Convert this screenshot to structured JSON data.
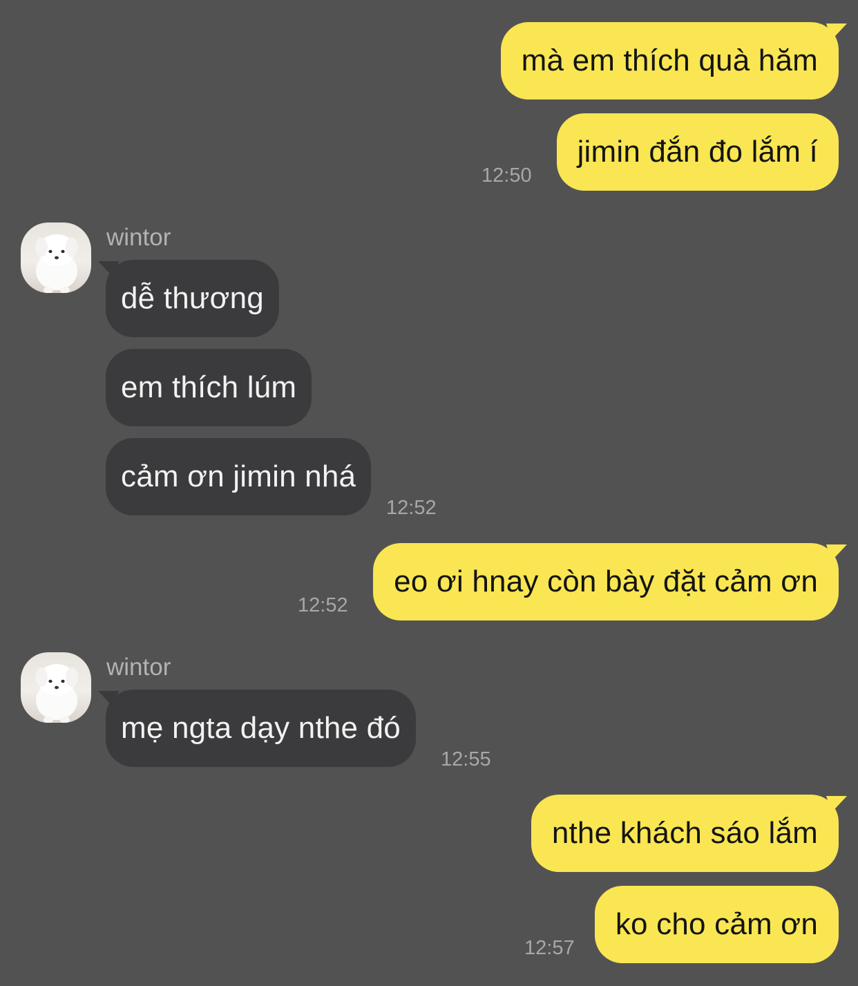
{
  "conversation": {
    "messages": [
      {
        "text": "mà em thích quà hăm"
      },
      {
        "text": "jimin đắn đo lắm í",
        "time": "12:50"
      },
      {
        "sender": "wintor",
        "text": "dễ thương"
      },
      {
        "text": "em thích lúm"
      },
      {
        "text": "cảm ơn jimin nhá",
        "time": "12:52"
      },
      {
        "text": "eo ơi hnay còn bày đặt cảm ơn",
        "time": "12:52"
      },
      {
        "sender": "wintor",
        "text": "mẹ ngta dạy nthe đó",
        "time": "12:55"
      },
      {
        "text": "nthe khách sáo lắm"
      },
      {
        "text": "ko cho cảm ơn",
        "time": "12:57"
      }
    ]
  },
  "colors": {
    "background": "#535253",
    "outgoing_bubble": "#f9e652",
    "incoming_bubble": "#3b3a3c",
    "timestamp": "#a9a7a9"
  },
  "icons": {
    "avatar": "white-dog-avatar-icon"
  }
}
